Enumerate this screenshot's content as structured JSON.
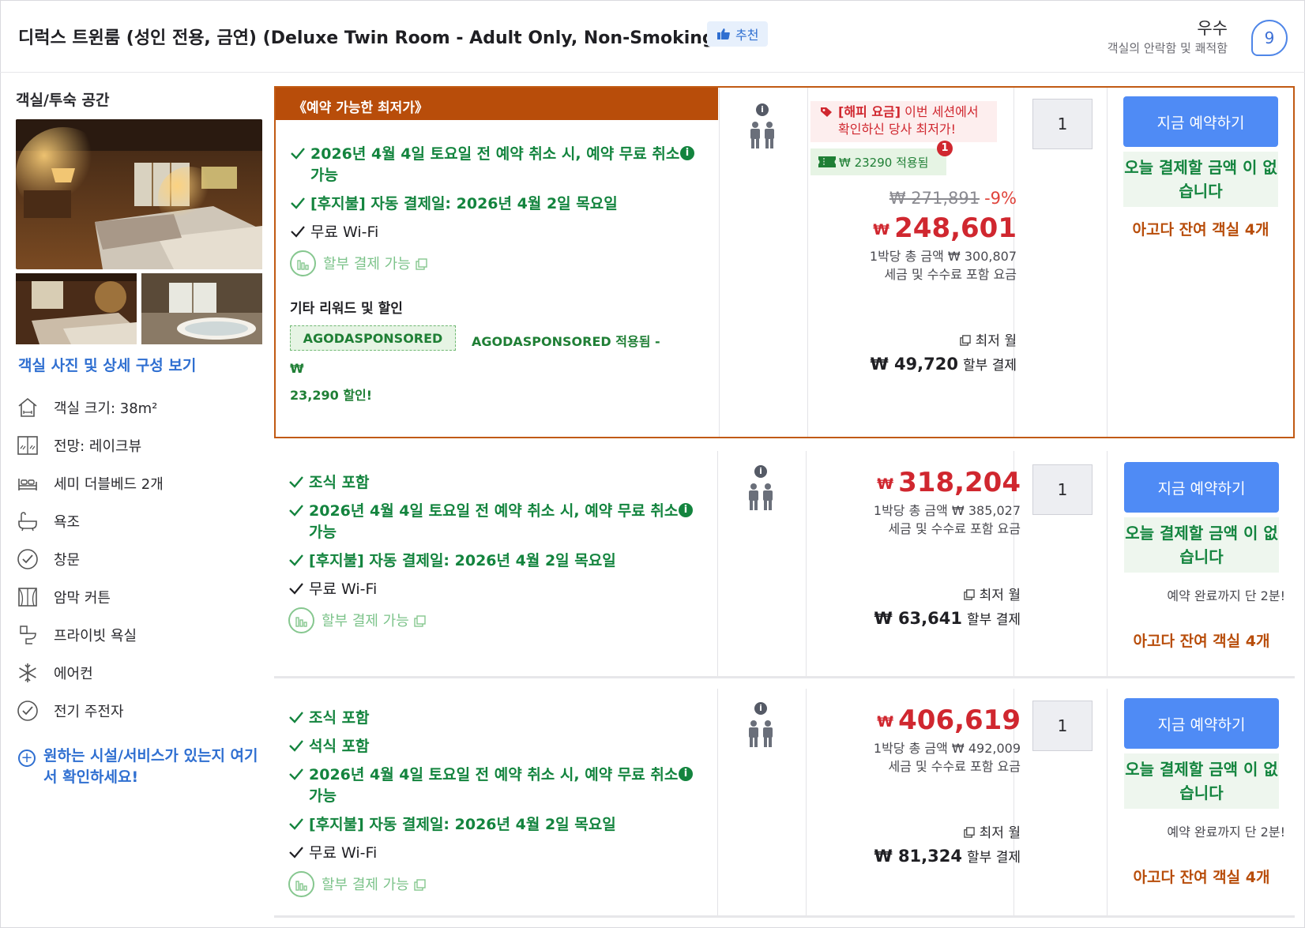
{
  "header": {
    "room_title": "디럭스 트윈룸 (성인 전용, 금연) (Deluxe Twin Room - Adult Only, Non-Smoking)",
    "recommend_badge": "추천",
    "rating_word": "우수",
    "rating_sub": "객실의 안락함 및 쾌적함",
    "rating_score": "9"
  },
  "left": {
    "space_label": "객실/투숙 공간",
    "photos_link": "객실 사진 및 상세 구성 보기",
    "amenities": [
      {
        "icon": "room-size-icon",
        "label": "객실 크기: 38m²"
      },
      {
        "icon": "view-icon",
        "label": "전망: 레이크뷰"
      },
      {
        "icon": "bed-icon",
        "label": "세미 더블베드 2개"
      },
      {
        "icon": "bathtub-icon",
        "label": "욕조"
      },
      {
        "icon": "check-circle-icon",
        "label": "창문"
      },
      {
        "icon": "curtain-icon",
        "label": "암막 커튼"
      },
      {
        "icon": "toilet-icon",
        "label": "프라이빗 욕실"
      },
      {
        "icon": "snowflake-icon",
        "label": "에어컨"
      },
      {
        "icon": "check-circle-icon",
        "label": "전기 주전자"
      }
    ],
    "facility_link": "원하는 시설/서비스가 있는지 여기서 확인하세요!"
  },
  "offers": [
    {
      "banner": "《예약 가능한 최저가》",
      "benefits": [
        "2026년 4월 4일 토요일 전 예약 취소 시, 예약 무료 취소 가능",
        "[후지불] 자동 결제일: 2026년 4월 2일 목요일",
        "무료 Wi-Fi"
      ],
      "installment": "할부 결제 가능",
      "rewards_title": "기타 리워드 및 할인",
      "coupon_code": "AGODASPONSORED",
      "coupon_note_1": "AGODASPONSORED 적용됨 - ₩",
      "coupon_note_2": "23,290 할인!",
      "happy_label": "[해피 요금]",
      "happy_text": "이번 세션에서 확인하신 당사 최저가!",
      "applied": "₩ 23290 적용됨",
      "applied_count": "1",
      "original_price": "₩ 271,891",
      "discount": "-9%",
      "currency": "₩",
      "price": "248,601",
      "per_night": "1박당 총 금액 ₩ 300,807",
      "tax_note": "세금 및 수수료 포함 요금",
      "monthly_label": "최저 월",
      "monthly_amount": "₩ 49,720",
      "monthly_suffix": "할부 결제",
      "qty": "1",
      "book_label": "지금 예약하기",
      "paynow": "오늘 결제할 금액 이 없습니다",
      "remain": "아고다 잔여 객실 4개"
    },
    {
      "benefits": [
        "조식 포함",
        "2026년 4월 4일 토요일 전 예약 취소 시, 예약 무료 취소 가능",
        "[후지불] 자동 결제일: 2026년 4월 2일 목요일",
        "무료 Wi-Fi"
      ],
      "installment": "할부 결제 가능",
      "currency": "₩",
      "price": "318,204",
      "per_night": "1박당 총 금액 ₩ 385,027",
      "tax_note": "세금 및 수수료 포함 요금",
      "monthly_label": "최저 월",
      "monthly_amount": "₩ 63,641",
      "monthly_suffix": "할부 결제",
      "qty": "1",
      "book_label": "지금 예약하기",
      "paynow": "오늘 결제할 금액 이 없습니다",
      "almost": "예약 완료까지 단 2분!",
      "remain": "아고다 잔여 객실 4개"
    },
    {
      "benefits": [
        "조식 포함",
        "석식 포함",
        "2026년 4월 4일 토요일 전 예약 취소 시, 예약 무료 취소 가능",
        "[후지불] 자동 결제일: 2026년 4월 2일 목요일",
        "무료 Wi-Fi"
      ],
      "installment": "할부 결제 가능",
      "currency": "₩",
      "price": "406,619",
      "per_night": "1박당 총 금액 ₩ 492,009",
      "tax_note": "세금 및 수수료 포함 요금",
      "monthly_label": "최저 월",
      "monthly_amount": "₩ 81,324",
      "monthly_suffix": "할부 결제",
      "qty": "1",
      "book_label": "지금 예약하기",
      "paynow": "오늘 결제할 금액 이 없습니다",
      "almost": "예약 완료까지 단 2분!",
      "remain": "아고다 잔여 객실 4개"
    }
  ]
}
